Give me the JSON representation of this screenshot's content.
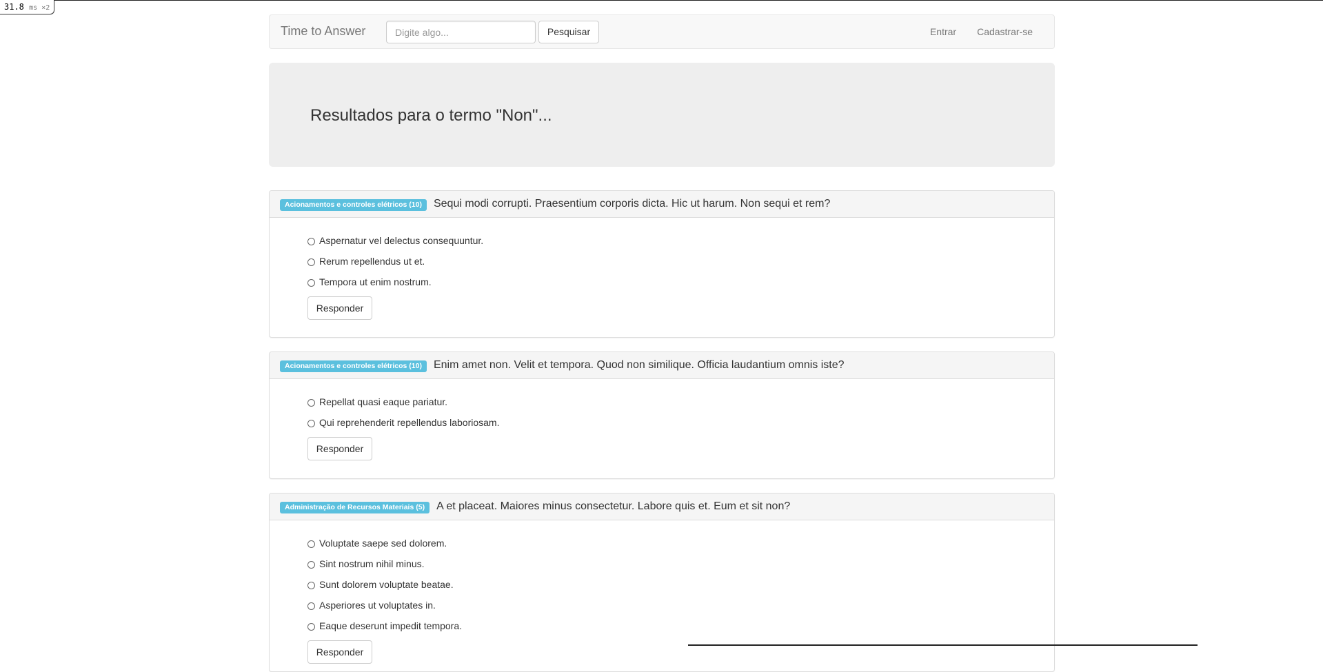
{
  "perf": {
    "value": "31.8",
    "unit": "ms ×2"
  },
  "navbar": {
    "brand": "Time to Answer",
    "search_placeholder": "Digite algo...",
    "search_button": "Pesquisar",
    "login": "Entrar",
    "signup": "Cadastrar-se"
  },
  "jumbotron": {
    "title": "Resultados para o termo \"Non\"..."
  },
  "questions": [
    {
      "subject": "Acionamentos e controles elétricos (10)",
      "text": "Sequi modi corrupti. Praesentium corporis dicta. Hic ut harum. Non sequi et rem?",
      "options": [
        "Aspernatur vel delectus consequuntur.",
        "Rerum repellendus ut et.",
        "Tempora ut enim nostrum."
      ],
      "button": "Responder"
    },
    {
      "subject": "Acionamentos e controles elétricos (10)",
      "text": "Enim amet non. Velit et tempora. Quod non similique. Officia laudantium omnis iste?",
      "options": [
        "Repellat quasi eaque pariatur.",
        "Qui reprehenderit repellendus laboriosam."
      ],
      "button": "Responder"
    },
    {
      "subject": "Administração de Recursos Materiais (5)",
      "text": "A et placeat. Maiores minus consectetur. Labore quis et. Eum et sit non?",
      "options": [
        "Voluptate saepe sed dolorem.",
        "Sint nostrum nihil minus.",
        "Sunt dolorem voluptate beatae.",
        "Asperiores ut voluptates in.",
        "Eaque deserunt impedit tempora."
      ],
      "button": "Responder"
    }
  ],
  "colors": {
    "label_bg": "#5bc0de",
    "jumbotron_bg": "#eeeeee",
    "navbar_bg": "#f8f8f8"
  }
}
